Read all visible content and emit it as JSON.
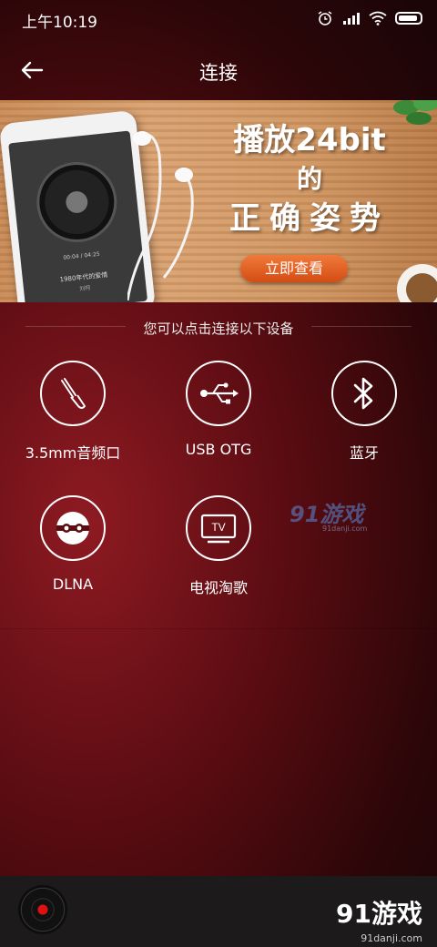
{
  "status_bar": {
    "time": "上午10:19",
    "icons": [
      "alarm-icon",
      "signal-icon",
      "wifi-icon",
      "battery-icon"
    ]
  },
  "header": {
    "title": "连接",
    "back_icon": "arrow-left-icon"
  },
  "banner": {
    "title_line1": "播放24bit",
    "title_line2": "的",
    "title_line3": "正确姿势",
    "cta_label": "立即查看",
    "phone_screen": {
      "time": "00:04 / 04:25",
      "song": "1980年代的爱情",
      "artist": "刘柯"
    }
  },
  "section": {
    "hint": "您可以点击连接以下设备"
  },
  "devices": [
    {
      "label": "3.5mm音频口",
      "icon": "audio-jack-icon"
    },
    {
      "label": "USB OTG",
      "icon": "usb-icon"
    },
    {
      "label": "蓝牙",
      "icon": "bluetooth-icon"
    },
    {
      "label": "DLNA",
      "icon": "dlna-icon"
    },
    {
      "label": "电视淘歌",
      "icon": "tv-icon",
      "icon_text": "TV"
    }
  ],
  "watermark": {
    "big": "91游戏",
    "small": "91danji.com"
  },
  "player": {
    "disc_icon": "vinyl-record-icon"
  },
  "brand": {
    "big": "91游戏",
    "small": "91danji.com"
  },
  "colors": {
    "background": "#5a0c12",
    "accent": "#d44c14",
    "player_bar": "#1c1a1a"
  }
}
